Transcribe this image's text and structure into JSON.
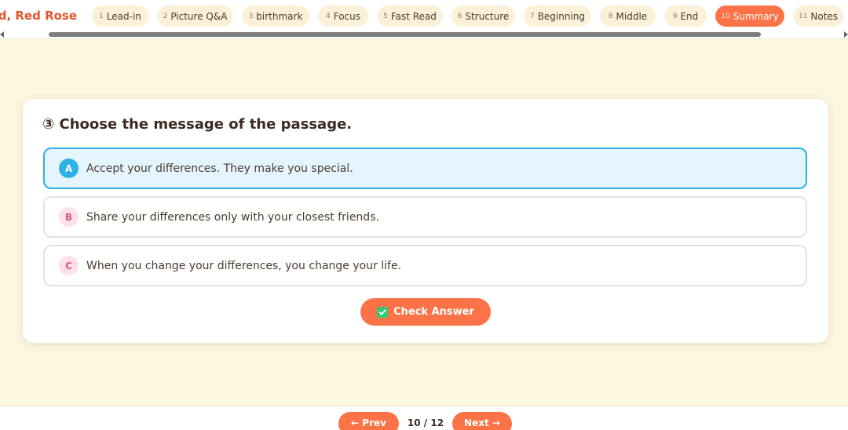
{
  "header": {
    "title": "Red, Red Rose",
    "tabs": [
      {
        "num": "1",
        "label": "Lead-in"
      },
      {
        "num": "2",
        "label": "Picture Q&A"
      },
      {
        "num": "3",
        "label": "birthmark"
      },
      {
        "num": "4",
        "label": "Focus"
      },
      {
        "num": "5",
        "label": "Fast Read"
      },
      {
        "num": "6",
        "label": "Structure"
      },
      {
        "num": "7",
        "label": "Beginning"
      },
      {
        "num": "8",
        "label": "Middle"
      },
      {
        "num": "9",
        "label": "End"
      },
      {
        "num": "10",
        "label": "Summary"
      },
      {
        "num": "11",
        "label": "Notes"
      }
    ],
    "active_tab": "Summary"
  },
  "question": {
    "text": "③ Choose the message of the passage.",
    "options": [
      {
        "letter": "A",
        "text": "Accept your differences. They make you special.",
        "selected": true
      },
      {
        "letter": "B",
        "text": "Share your differences only with your closest friends.",
        "selected": false
      },
      {
        "letter": "C",
        "text": "When you change your differences, you change your life.",
        "selected": false
      }
    ],
    "check_label": "Check Answer",
    "check_icon": "check-mark-icon"
  },
  "footer": {
    "prev_label": "← Prev",
    "next_label": "Next →",
    "page": "10 / 12"
  },
  "colors": {
    "accent": "#fb7346",
    "selected": "#2eb1e6",
    "background": "#fdf6e0"
  }
}
